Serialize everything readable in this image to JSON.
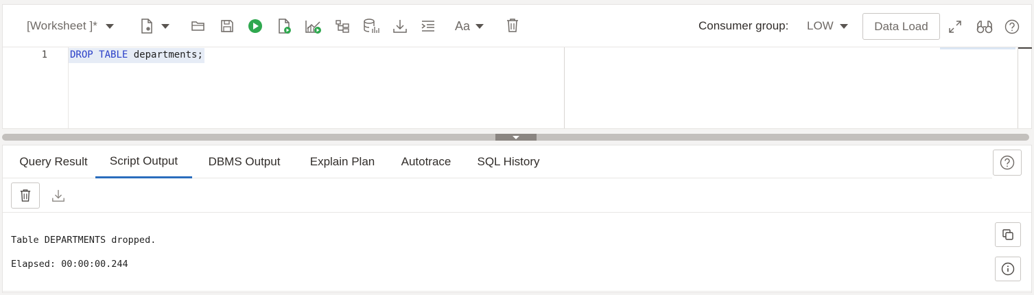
{
  "toolbar": {
    "worksheet_label": "[Worksheet ]*",
    "consumer_group_label": "Consumer group:",
    "consumer_group_value": "LOW",
    "data_load_label": "Data Load",
    "font_label": "Aa",
    "icons": [
      "new-file-icon",
      "open-folder-icon",
      "save-icon",
      "run-statement-icon",
      "run-script-icon",
      "explain-plan-icon",
      "autotrace-icon",
      "database-stats-icon",
      "download-icon",
      "format-icon",
      "font-size-icon",
      "trash-icon",
      "expand-icon",
      "binoculars-icon",
      "help-icon"
    ],
    "accent_green": "#2fa84f"
  },
  "editor": {
    "line_number": "1",
    "keyword_drop": "DROP",
    "keyword_table": "TABLE",
    "identifier": "departments;"
  },
  "tabs": [
    {
      "label": "Query Result",
      "active": false
    },
    {
      "label": "Script Output",
      "active": true
    },
    {
      "label": "DBMS Output",
      "active": false
    },
    {
      "label": "Explain Plan",
      "active": false
    },
    {
      "label": "Autotrace",
      "active": false
    },
    {
      "label": "SQL History",
      "active": false
    }
  ],
  "output": {
    "line1": "Table DEPARTMENTS dropped.",
    "line2": "Elapsed: 00:00:00.244"
  },
  "colors": {
    "active_tab_underline": "#2a6dbd",
    "keyword_blue": "#2a3fc8"
  }
}
